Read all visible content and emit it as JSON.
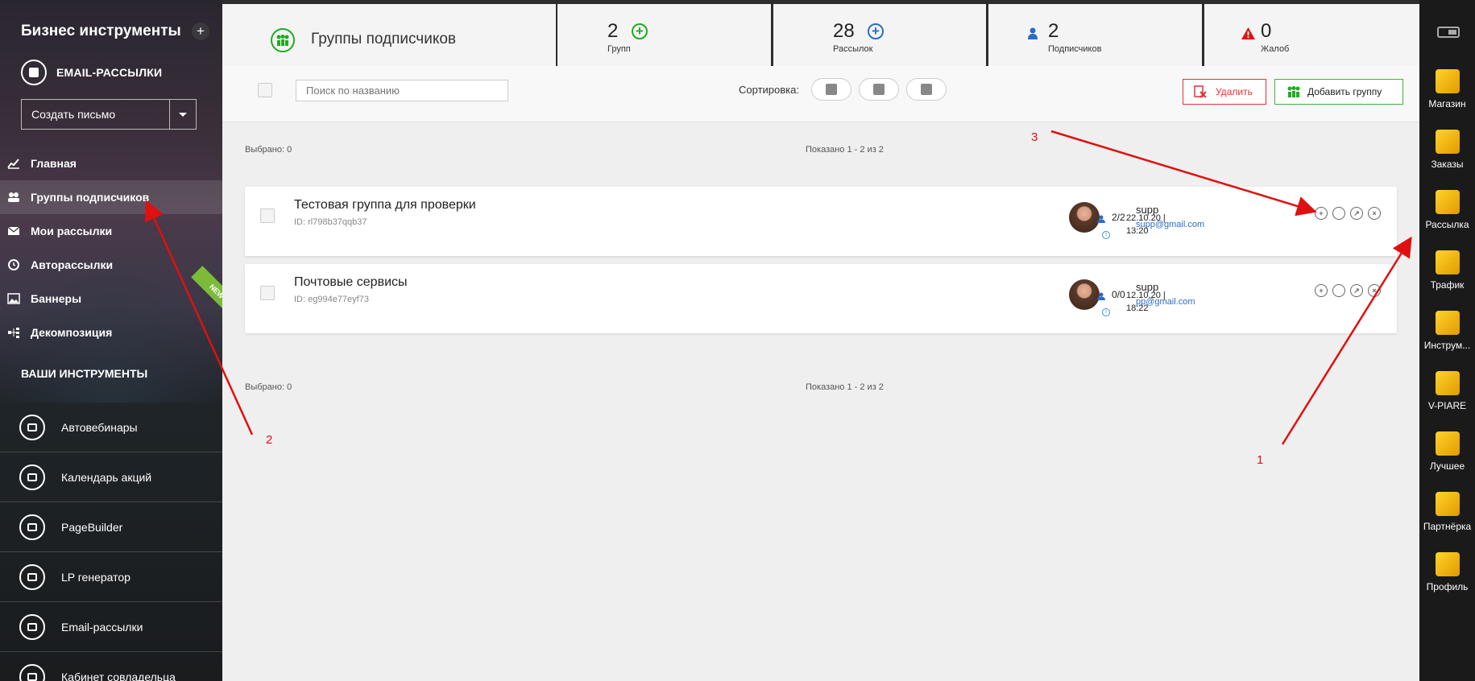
{
  "sidebar": {
    "title": "Бизнес инструменты",
    "plus": "+",
    "section1": "EMAIL-РАССЫЛКИ",
    "create_button": "Создать письмо",
    "nav": [
      {
        "label": "Главная",
        "icon": "chart-line-icon"
      },
      {
        "label": "Группы подписчиков",
        "icon": "users-icon",
        "active": true
      },
      {
        "label": "Мои рассылки",
        "icon": "envelope-icon"
      },
      {
        "label": "Авторассылки",
        "icon": "clock-icon"
      },
      {
        "label": "Баннеры",
        "icon": "image-icon"
      },
      {
        "label": "Декомпозиция",
        "icon": "sitemap-icon"
      }
    ],
    "new_badge": "NEW",
    "section2": "ВАШИ ИНСТРУМЕНТЫ",
    "tools": [
      {
        "label": "Автовебинары",
        "icon": "webinar-icon"
      },
      {
        "label": "Календарь акций",
        "icon": "calendar-icon"
      },
      {
        "label": "PageBuilder",
        "icon": "pagebuilder-icon"
      },
      {
        "label": "LP генератор",
        "icon": "lp-generator-icon"
      },
      {
        "label": "Email-рассылки",
        "icon": "email-icon"
      },
      {
        "label": "Кабинет совладельца",
        "icon": "handshake-icon"
      }
    ]
  },
  "stats": {
    "page_title": "Группы подписчиков",
    "groups": {
      "value": "2",
      "label": "Групп"
    },
    "mailings": {
      "value": "28",
      "label": "Рассылок"
    },
    "subscribers": {
      "value": "2",
      "label": "Подписчиков"
    },
    "complaints": {
      "value": "0",
      "label": "Жалоб"
    }
  },
  "toolbar": {
    "search_placeholder": "Поиск по названию",
    "sort_label": "Сортировка:",
    "delete_label": "Удалить",
    "add_label": "Добавить группу"
  },
  "list": {
    "selected_top": "Выбрано: 0",
    "shown_top": "Показано 1 - 2 из 2",
    "selected_bottom": "Выбрано: 0",
    "shown_bottom": "Показано 1 - 2 из 2",
    "groups": [
      {
        "name": "Тестовая группа для проверки",
        "id": "ID: rl798b37qqb37",
        "owner": "supp",
        "email": "supp@gmail.com",
        "count": "2/2",
        "date": "22.10.20 |",
        "time": "13:20"
      },
      {
        "name": "Почтовые сервисы",
        "id": "ID: eg994e77eyf73",
        "owner": "supp",
        "email": "pp@gmail.com",
        "count": "0/0",
        "date": "12.10.20 |",
        "time": "18:22"
      }
    ]
  },
  "rightbar": [
    {
      "label": "Магазин",
      "icon": "shop-bag-icon"
    },
    {
      "label": "Заказы",
      "icon": "orders-icon"
    },
    {
      "label": "Рассылка",
      "icon": "plane-icon"
    },
    {
      "label": "Трафик",
      "icon": "mouse-icon"
    },
    {
      "label": "Инструм...",
      "icon": "toolbox-icon"
    },
    {
      "label": "V-PIARE",
      "icon": "megaphone-icon"
    },
    {
      "label": "Лучшее",
      "icon": "trophy-icon"
    },
    {
      "label": "Партнёрка",
      "icon": "pyramid-icon"
    },
    {
      "label": "Профиль",
      "icon": "basket-icon"
    }
  ],
  "annotations": {
    "a1": "1",
    "a2": "2",
    "a3": "3"
  },
  "colors": {
    "accent_green": "#22aa22",
    "accent_blue": "#2a6cc8",
    "danger_red": "#e53030",
    "annotation_red": "#e01010"
  }
}
